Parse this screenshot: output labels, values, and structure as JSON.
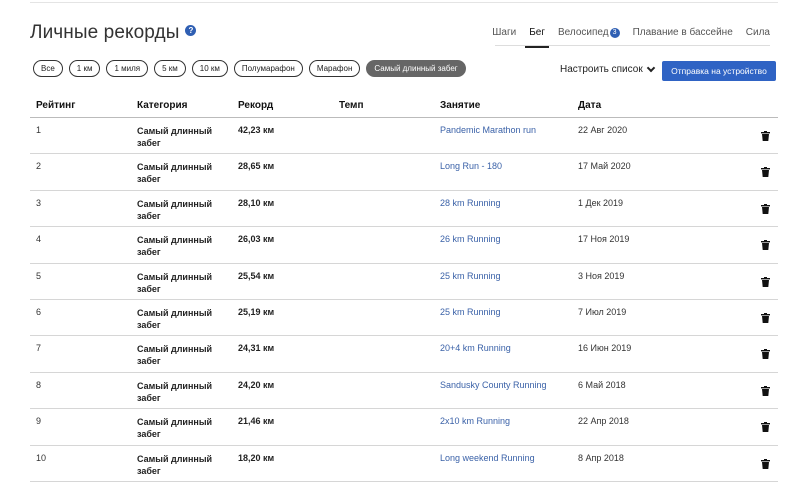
{
  "page": {
    "title": "Личные рекорды"
  },
  "tabs": [
    {
      "label": "Шаги",
      "active": false
    },
    {
      "label": "Бег",
      "active": true
    },
    {
      "label": "Велосипед",
      "active": false,
      "badge": "3"
    },
    {
      "label": "Плавание в бассейне",
      "active": false
    },
    {
      "label": "Сила",
      "active": false
    }
  ],
  "filters": [
    {
      "label": "Все",
      "active": false
    },
    {
      "label": "1 км",
      "active": false
    },
    {
      "label": "1 миля",
      "active": false
    },
    {
      "label": "5 км",
      "active": false
    },
    {
      "label": "10 км",
      "active": false
    },
    {
      "label": "Полумарафон",
      "active": false
    },
    {
      "label": "Марафон",
      "active": false
    },
    {
      "label": "Самый длинный забег",
      "active": true
    }
  ],
  "toolbar": {
    "customize_label": "Настроить список",
    "send_label": "Отправка на устройство"
  },
  "table": {
    "headers": {
      "rank": "Рейтинг",
      "category": "Категория",
      "record": "Рекорд",
      "pace": "Темп",
      "activity": "Занятие",
      "date": "Дата"
    },
    "rows": [
      {
        "rank": "1",
        "category": "Самый длинный забег",
        "record": "42,23 км",
        "pace": "",
        "activity": "Pandemic Marathon run",
        "date": "22 Авг 2020"
      },
      {
        "rank": "2",
        "category": "Самый длинный забег",
        "record": "28,65 км",
        "pace": "",
        "activity": "Long Run - 180",
        "date": "17 Май 2020"
      },
      {
        "rank": "3",
        "category": "Самый длинный забег",
        "record": "28,10 км",
        "pace": "",
        "activity": "28 km Running",
        "date": "1 Дек 2019"
      },
      {
        "rank": "4",
        "category": "Самый длинный забег",
        "record": "26,03 км",
        "pace": "",
        "activity": "26 km Running",
        "date": "17 Ноя 2019"
      },
      {
        "rank": "5",
        "category": "Самый длинный забег",
        "record": "25,54 км",
        "pace": "",
        "activity": "25 km Running",
        "date": "3 Ноя 2019"
      },
      {
        "rank": "6",
        "category": "Самый длинный забег",
        "record": "25,19 км",
        "pace": "",
        "activity": "25 km Running",
        "date": "7 Июл 2019"
      },
      {
        "rank": "7",
        "category": "Самый длинный забег",
        "record": "24,31 км",
        "pace": "",
        "activity": "20+4 km Running",
        "date": "16 Июн 2019"
      },
      {
        "rank": "8",
        "category": "Самый длинный забег",
        "record": "24,20 км",
        "pace": "",
        "activity": "Sandusky County Running",
        "date": "6 Май 2018"
      },
      {
        "rank": "9",
        "category": "Самый длинный забег",
        "record": "21,46 км",
        "pace": "",
        "activity": "2x10 km Running",
        "date": "22 Апр 2018"
      },
      {
        "rank": "10",
        "category": "Самый длинный забег",
        "record": "18,20 км",
        "pace": "",
        "activity": "Long weekend Running",
        "date": "8 Апр 2018"
      }
    ]
  },
  "colors": {
    "accent": "#2f63c4",
    "link": "#3b62a8",
    "active_chip": "#666666"
  },
  "icons": {
    "help": "help-icon",
    "trash": "trash-icon",
    "chevron": "chevron-down-icon"
  }
}
